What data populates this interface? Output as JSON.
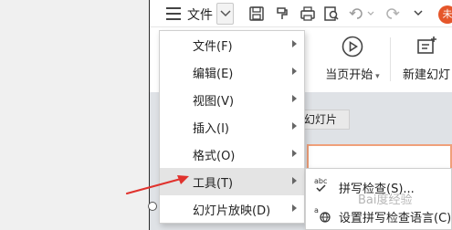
{
  "toolbar": {
    "file_label": "文件",
    "avatar_initial": "未"
  },
  "ribbon": {
    "items": [
      {
        "label": "当页开始",
        "icon": "play-circle-icon"
      },
      {
        "label": "新建幻灯",
        "icon": "new-slide-icon"
      }
    ]
  },
  "canvas": {
    "tab_label": "幻灯片"
  },
  "menu": {
    "items": [
      {
        "label": "文件(F)"
      },
      {
        "label": "编辑(E)"
      },
      {
        "label": "视图(V)"
      },
      {
        "label": "插入(I)"
      },
      {
        "label": "格式(O)"
      },
      {
        "label": "工具(T)",
        "active": true
      },
      {
        "label": "幻灯片放映(D)"
      }
    ]
  },
  "submenu": {
    "items": [
      {
        "label": "拼写检查(S)...",
        "icon": "spell-check-icon"
      },
      {
        "label": "设置拼写检查语言(C)",
        "icon": "globe-language-icon"
      }
    ]
  },
  "watermark": "Bai度经验",
  "colors": {
    "accent": "#e5562a",
    "arrow": "#e0322d",
    "active_item": "#e4e4e4"
  }
}
